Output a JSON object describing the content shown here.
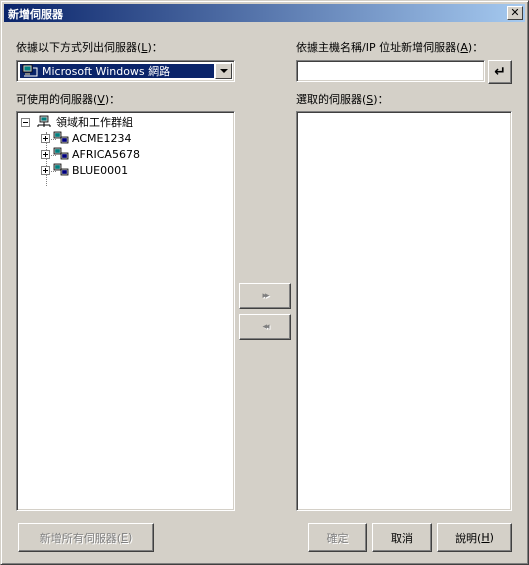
{
  "window": {
    "title": "新增伺服器",
    "close_label": "✕"
  },
  "list_by": {
    "label_prefix": "依據以下方式列出伺服器(",
    "hotkey": "L",
    "label_suffix": ")：",
    "selected": "Microsoft Windows 網路"
  },
  "add_by_name": {
    "label_prefix": "依據主機名稱/IP 位址新增伺服器(",
    "hotkey": "A",
    "label_suffix": ")：",
    "value": "",
    "enter_glyph": "↵"
  },
  "available": {
    "label_prefix": "可使用的伺服器(",
    "hotkey": "V",
    "label_suffix": ")：",
    "root": "領域和工作群組",
    "items": [
      "ACME1234",
      "AFRICA5678",
      "BLUE0001"
    ]
  },
  "selected_list": {
    "label_prefix": "選取的伺服器(",
    "hotkey": "S",
    "label_suffix": ")："
  },
  "move": {
    "add_glyph": "▸▸",
    "remove_glyph": "◂◂"
  },
  "buttons": {
    "add_all_prefix": "新增所有伺服器(",
    "add_all_hotkey": "E",
    "add_all_suffix": ")",
    "ok": "確定",
    "cancel": "取消",
    "help_prefix": "說明(",
    "help_hotkey": "H",
    "help_suffix": ")"
  },
  "icons": {
    "computer": "network-computer-icon",
    "root": "network-root-icon"
  },
  "colors": {
    "selection": "#0a246a",
    "face": "#d4d0c8"
  }
}
